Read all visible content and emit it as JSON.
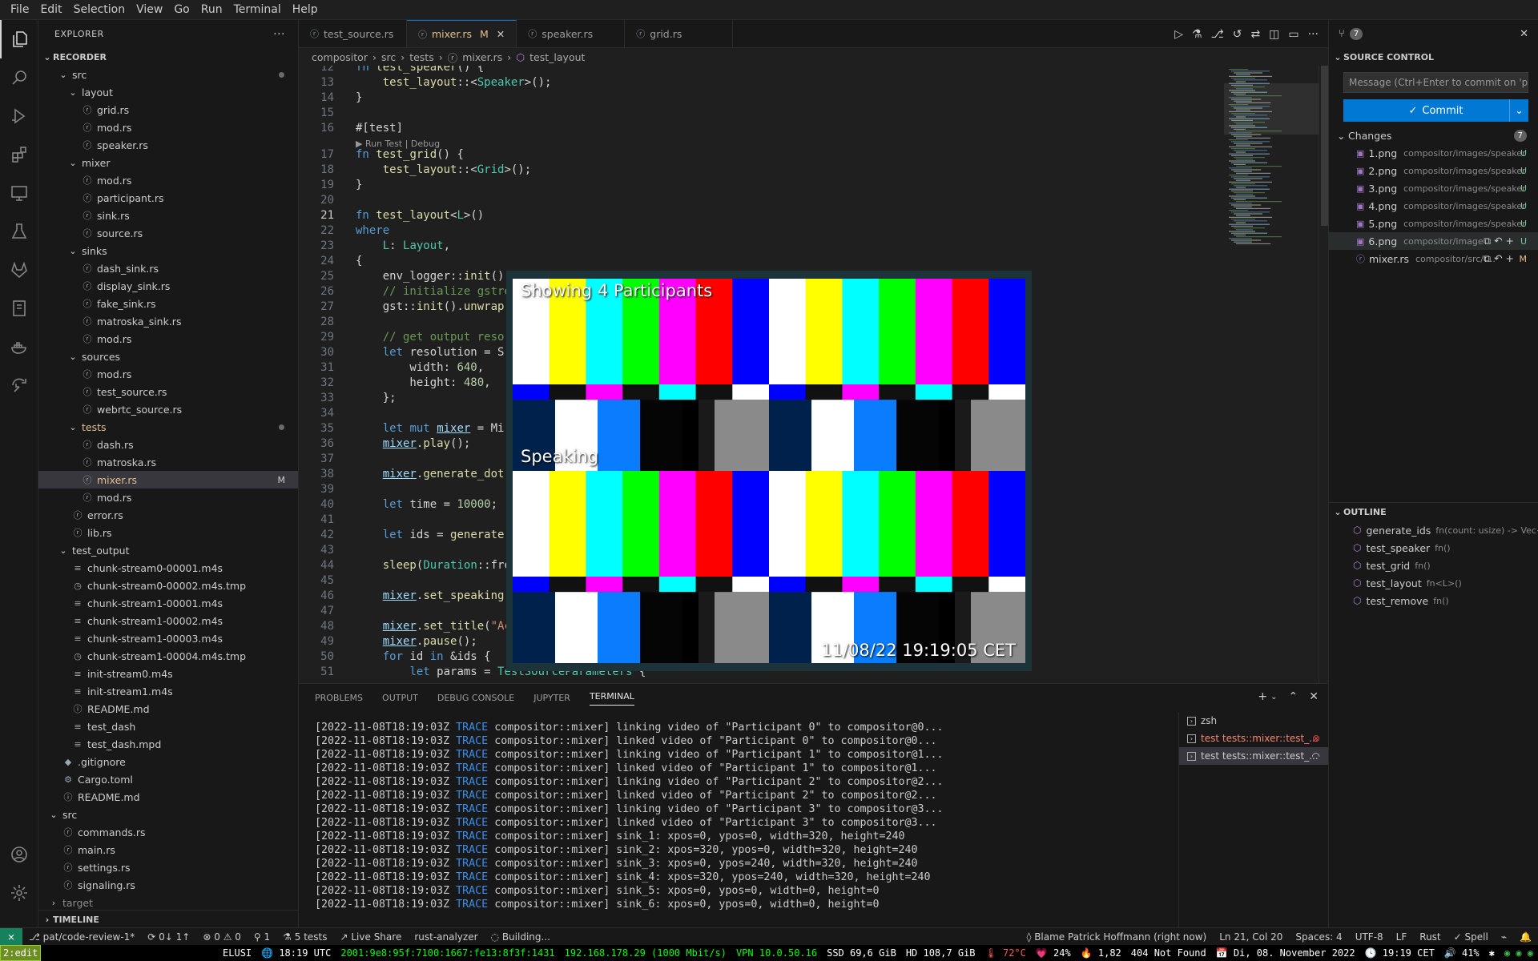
{
  "menubar": {
    "items": [
      "File",
      "Edit",
      "Selection",
      "View",
      "Go",
      "Run",
      "Terminal",
      "Help"
    ]
  },
  "explorer": {
    "title": "EXPLORER",
    "section": "RECORDER",
    "timeline": "TIMELINE",
    "tree": [
      {
        "label": "src",
        "depth": 1,
        "kind": "folder",
        "open": true,
        "dot": true
      },
      {
        "label": "layout",
        "depth": 2,
        "kind": "folder",
        "open": true
      },
      {
        "label": "grid.rs",
        "depth": 3,
        "kind": "file"
      },
      {
        "label": "mod.rs",
        "depth": 3,
        "kind": "file"
      },
      {
        "label": "speaker.rs",
        "depth": 3,
        "kind": "file"
      },
      {
        "label": "mixer",
        "depth": 2,
        "kind": "folder",
        "open": true
      },
      {
        "label": "mod.rs",
        "depth": 3,
        "kind": "file"
      },
      {
        "label": "participant.rs",
        "depth": 3,
        "kind": "file"
      },
      {
        "label": "sink.rs",
        "depth": 3,
        "kind": "file"
      },
      {
        "label": "source.rs",
        "depth": 3,
        "kind": "file"
      },
      {
        "label": "sinks",
        "depth": 2,
        "kind": "folder",
        "open": true
      },
      {
        "label": "dash_sink.rs",
        "depth": 3,
        "kind": "file"
      },
      {
        "label": "display_sink.rs",
        "depth": 3,
        "kind": "file"
      },
      {
        "label": "fake_sink.rs",
        "depth": 3,
        "kind": "file"
      },
      {
        "label": "matroska_sink.rs",
        "depth": 3,
        "kind": "file"
      },
      {
        "label": "mod.rs",
        "depth": 3,
        "kind": "file"
      },
      {
        "label": "sources",
        "depth": 2,
        "kind": "folder",
        "open": true
      },
      {
        "label": "mod.rs",
        "depth": 3,
        "kind": "file"
      },
      {
        "label": "test_source.rs",
        "depth": 3,
        "kind": "file"
      },
      {
        "label": "webrtc_source.rs",
        "depth": 3,
        "kind": "file"
      },
      {
        "label": "tests",
        "depth": 2,
        "kind": "folder",
        "open": true,
        "dot": true,
        "mod": true
      },
      {
        "label": "dash.rs",
        "depth": 3,
        "kind": "file"
      },
      {
        "label": "matroska.rs",
        "depth": 3,
        "kind": "file"
      },
      {
        "label": "mixer.rs",
        "depth": 3,
        "kind": "file",
        "selected": true,
        "badge": "M",
        "mod": true
      },
      {
        "label": "mod.rs",
        "depth": 3,
        "kind": "file"
      },
      {
        "label": "error.rs",
        "depth": 2,
        "kind": "file"
      },
      {
        "label": "lib.rs",
        "depth": 2,
        "kind": "file"
      },
      {
        "label": "test_output",
        "depth": 1,
        "kind": "folder",
        "open": true
      },
      {
        "label": "chunk-stream0-00001.m4s",
        "depth": 2,
        "kind": "lines"
      },
      {
        "label": "chunk-stream0-00002.m4s.tmp",
        "depth": 2,
        "kind": "clock"
      },
      {
        "label": "chunk-stream1-00001.m4s",
        "depth": 2,
        "kind": "lines"
      },
      {
        "label": "chunk-stream1-00002.m4s",
        "depth": 2,
        "kind": "lines"
      },
      {
        "label": "chunk-stream1-00003.m4s",
        "depth": 2,
        "kind": "lines"
      },
      {
        "label": "chunk-stream1-00004.m4s.tmp",
        "depth": 2,
        "kind": "clock"
      },
      {
        "label": "init-stream0.m4s",
        "depth": 2,
        "kind": "lines"
      },
      {
        "label": "init-stream1.m4s",
        "depth": 2,
        "kind": "lines"
      },
      {
        "label": "README.md",
        "depth": 2,
        "kind": "info"
      },
      {
        "label": "test_dash",
        "depth": 2,
        "kind": "lines"
      },
      {
        "label": "test_dash.mpd",
        "depth": 2,
        "kind": "lines"
      },
      {
        "label": ".gitignore",
        "depth": 1,
        "kind": "git"
      },
      {
        "label": "Cargo.toml",
        "depth": 1,
        "kind": "gear"
      },
      {
        "label": "README.md",
        "depth": 1,
        "kind": "info"
      },
      {
        "label": "src",
        "depth": 0,
        "kind": "folder",
        "open": true
      },
      {
        "label": "commands.rs",
        "depth": 1,
        "kind": "file"
      },
      {
        "label": "main.rs",
        "depth": 1,
        "kind": "file"
      },
      {
        "label": "settings.rs",
        "depth": 1,
        "kind": "file"
      },
      {
        "label": "signaling.rs",
        "depth": 1,
        "kind": "file"
      },
      {
        "label": "target",
        "depth": 0,
        "kind": "folder",
        "open": false,
        "dim": true
      }
    ]
  },
  "tabs": [
    {
      "label": "test_source.rs"
    },
    {
      "label": "mixer.rs",
      "badge": "M",
      "active": true
    },
    {
      "label": "speaker.rs"
    },
    {
      "label": "grid.rs"
    }
  ],
  "breadcrumb": [
    "compositor",
    "src",
    "tests",
    "mixer.rs",
    "test_layout"
  ],
  "code": [
    {
      "n": "12",
      "t": "fn test_speaker() {",
      "partial": true
    },
    {
      "n": "13",
      "t": "    test_layout::<Speaker>();"
    },
    {
      "n": "14",
      "t": "}"
    },
    {
      "n": "15",
      "t": ""
    },
    {
      "n": "16",
      "t": "#[test]"
    },
    {
      "lens": "▶ Run Test | Debug"
    },
    {
      "n": "17",
      "t": "fn test_grid() {"
    },
    {
      "n": "18",
      "t": "    test_layout::<Grid>();"
    },
    {
      "n": "19",
      "t": "}"
    },
    {
      "n": "20",
      "t": ""
    },
    {
      "n": "21",
      "t": "fn test_layout<L>()",
      "cur": true
    },
    {
      "n": "22",
      "t": "where"
    },
    {
      "n": "23",
      "t": "    L: Layout,"
    },
    {
      "n": "24",
      "t": "{"
    },
    {
      "n": "25",
      "t": "    env_logger::init()"
    },
    {
      "n": "26",
      "t": "    // initialize gstre"
    },
    {
      "n": "27",
      "t": "    gst::init().unwrap"
    },
    {
      "n": "28",
      "t": ""
    },
    {
      "n": "29",
      "t": "    // get output reso"
    },
    {
      "n": "30",
      "t": "    let resolution = S"
    },
    {
      "n": "31",
      "t": "        width: 640,"
    },
    {
      "n": "32",
      "t": "        height: 480,"
    },
    {
      "n": "33",
      "t": "    };"
    },
    {
      "n": "34",
      "t": ""
    },
    {
      "n": "35",
      "t": "    let mut mixer = Mi"
    },
    {
      "n": "36",
      "t": "    mixer.play();"
    },
    {
      "n": "37",
      "t": ""
    },
    {
      "n": "38",
      "t": "    mixer.generate_dot"
    },
    {
      "n": "39",
      "t": ""
    },
    {
      "n": "40",
      "t": "    let time = 10000;"
    },
    {
      "n": "41",
      "t": ""
    },
    {
      "n": "42",
      "t": "    let ids = generate"
    },
    {
      "n": "43",
      "t": ""
    },
    {
      "n": "44",
      "t": "    sleep(Duration::fro"
    },
    {
      "n": "45",
      "t": ""
    },
    {
      "n": "46",
      "t": "    mixer.set_speaking"
    },
    {
      "n": "47",
      "t": ""
    },
    {
      "n": "48",
      "t": "    mixer.set_title(\"Ac"
    },
    {
      "n": "49",
      "t": "    mixer.pause();"
    },
    {
      "n": "50",
      "t": "    for id in &ids {"
    },
    {
      "n": "51",
      "t": "        let params = TestSourceParameters {"
    }
  ],
  "video": {
    "title": "Showing 4 Participants",
    "speaking": "Speaking",
    "timestamp": "11/08/22 19:19:05 CET"
  },
  "panel": {
    "tabs": [
      "PROBLEMS",
      "OUTPUT",
      "DEBUG CONSOLE",
      "JUPYTER",
      "TERMINAL"
    ],
    "terminal_lines": [
      {
        "ts": "[2022-11-08T18:19:03Z",
        "lvl": "TRACE",
        "msg": "compositor::mixer] linking video of \"Participant 0\" to compositor@0..."
      },
      {
        "ts": "[2022-11-08T18:19:03Z",
        "lvl": "TRACE",
        "msg": "compositor::mixer] linked video of \"Participant 0\" to compositor@0..."
      },
      {
        "ts": "[2022-11-08T18:19:03Z",
        "lvl": "TRACE",
        "msg": "compositor::mixer] linking video of \"Participant 1\" to compositor@1..."
      },
      {
        "ts": "[2022-11-08T18:19:03Z",
        "lvl": "TRACE",
        "msg": "compositor::mixer] linked video of \"Participant 1\" to compositor@1..."
      },
      {
        "ts": "[2022-11-08T18:19:03Z",
        "lvl": "TRACE",
        "msg": "compositor::mixer] linking video of \"Participant 2\" to compositor@2..."
      },
      {
        "ts": "[2022-11-08T18:19:03Z",
        "lvl": "TRACE",
        "msg": "compositor::mixer] linked video of \"Participant 2\" to compositor@2..."
      },
      {
        "ts": "[2022-11-08T18:19:03Z",
        "lvl": "TRACE",
        "msg": "compositor::mixer] linking video of \"Participant 3\" to compositor@3..."
      },
      {
        "ts": "[2022-11-08T18:19:03Z",
        "lvl": "TRACE",
        "msg": "compositor::mixer] linked video of \"Participant 3\" to compositor@3..."
      },
      {
        "ts": "[2022-11-08T18:19:03Z",
        "lvl": "TRACE",
        "msg": "compositor::mixer] sink_1: xpos=0, ypos=0, width=320, height=240"
      },
      {
        "ts": "[2022-11-08T18:19:03Z",
        "lvl": "TRACE",
        "msg": "compositor::mixer] sink_2: xpos=320, ypos=0, width=320, height=240"
      },
      {
        "ts": "[2022-11-08T18:19:03Z",
        "lvl": "TRACE",
        "msg": "compositor::mixer] sink_3: xpos=0, ypos=240, width=320, height=240"
      },
      {
        "ts": "[2022-11-08T18:19:03Z",
        "lvl": "TRACE",
        "msg": "compositor::mixer] sink_4: xpos=320, ypos=240, width=320, height=240"
      },
      {
        "ts": "[2022-11-08T18:19:03Z",
        "lvl": "TRACE",
        "msg": "compositor::mixer] sink_5: xpos=0, ypos=0, width=0, height=0"
      },
      {
        "ts": "[2022-11-08T18:19:03Z",
        "lvl": "TRACE",
        "msg": "compositor::mixer] sink_6: xpos=0, ypos=0, width=0, height=0"
      }
    ],
    "terminals": [
      {
        "label": "zsh"
      },
      {
        "label": "test tests::mixer::test_...",
        "state": "error"
      },
      {
        "label": "test tests::mixer::test_...",
        "state": "running"
      }
    ]
  },
  "scm": {
    "badge": "7",
    "title": "SOURCE CONTROL",
    "commit_placeholder": "Message (Ctrl+Enter to commit on 'pat/c...",
    "commit_label": "Commit",
    "changes_label": "Changes",
    "changes_count": "7",
    "changes": [
      {
        "name": "1.png",
        "path": "compositor/images/speaker",
        "status": "U"
      },
      {
        "name": "2.png",
        "path": "compositor/images/speaker",
        "status": "U"
      },
      {
        "name": "3.png",
        "path": "compositor/images/speaker",
        "status": "U"
      },
      {
        "name": "4.png",
        "path": "compositor/images/speaker",
        "status": "U"
      },
      {
        "name": "5.png",
        "path": "compositor/images/speaker",
        "status": "U"
      },
      {
        "name": "6.png",
        "path": "compositor/images/...",
        "status": "U",
        "hover": true
      },
      {
        "name": "mixer.rs",
        "path": "compositor/src/t...",
        "status": "M",
        "hover": true
      }
    ],
    "outline_title": "OUTLINE",
    "outline": [
      {
        "name": "generate_ids",
        "sig": "fn(count: usize) -> Vec<Strin..."
      },
      {
        "name": "test_speaker",
        "sig": "fn()"
      },
      {
        "name": "test_grid",
        "sig": "fn()"
      },
      {
        "name": "test_layout",
        "sig": "fn<L>()"
      },
      {
        "name": "test_remove",
        "sig": "fn()"
      }
    ]
  },
  "status": {
    "branch": "pat/code-review-1*",
    "sync": "0↓ 1↑",
    "errors": "0",
    "warnings": "0",
    "ports": "1",
    "tests": "5 tests",
    "liveshare": "Live Share",
    "analyzer": "rust-analyzer",
    "building": "Building...",
    "blame": "Blame Patrick Hoffmann (right now)",
    "position": "Ln 21, Col 20",
    "spaces": "Spaces: 4",
    "encoding": "UTF-8",
    "eol": "LF",
    "lang": "Rust",
    "spell": "Spell"
  },
  "i3bar": {
    "workspace": "2:edit",
    "items": [
      "ELUSI",
      "🌐 18:19 UTC",
      "2001:9e8:95f:7100:1667:fe13:8f3f:1431",
      "192.168.178.29 (1000 Mbit/s)",
      "VPN 10.0.50.16",
      "SSD 69,6 GiB",
      "HD 108,7 GiB",
      "🌡 72°C",
      "💗 24%",
      "🔥 1,82",
      "404 Not Found",
      "📅 Di, 08. November 2022",
      "🕓 19:19 CET",
      "🔊 41%"
    ],
    "colors": {
      "ip6": "#00ff00",
      "ip4": "#00ff00",
      "vpn": "#00ff00",
      "temp": "#ff5555"
    }
  }
}
